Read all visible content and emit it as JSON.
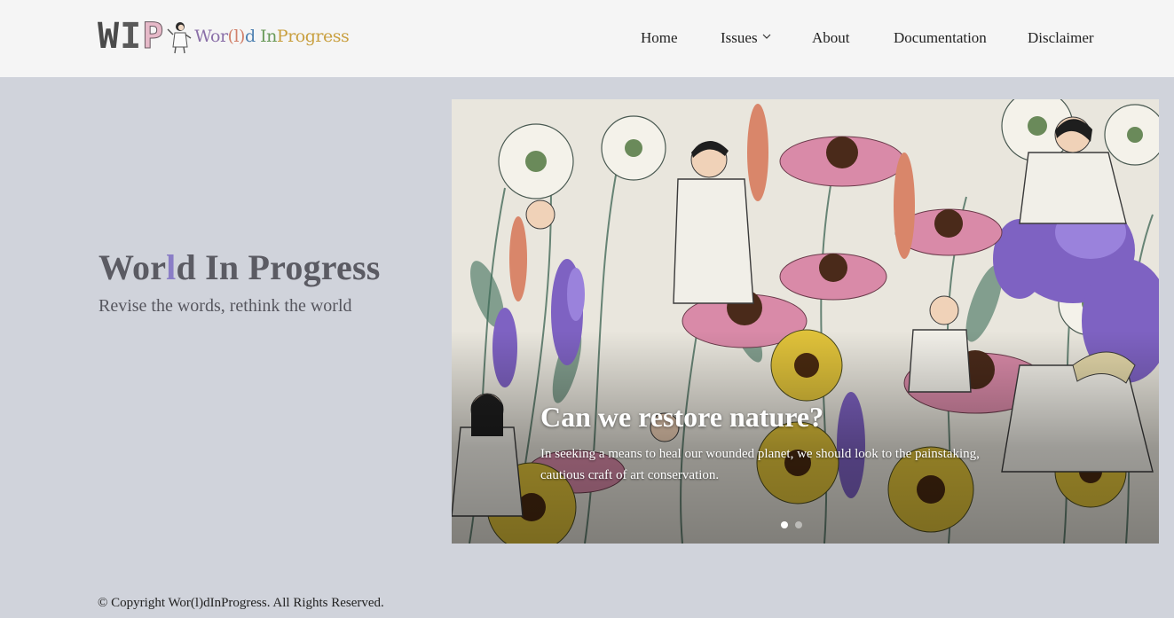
{
  "brand": {
    "logo_letters": [
      "W",
      "I",
      "P"
    ],
    "logo_script": [
      "Wor",
      "(l)",
      "d ",
      "In",
      "Progress"
    ],
    "logo_alt": "Wor(l)d In Progress"
  },
  "nav": {
    "items": [
      {
        "label": "Home"
      },
      {
        "label": "Issues",
        "has_dropdown": true
      },
      {
        "label": "About"
      },
      {
        "label": "Documentation"
      },
      {
        "label": "Disclaimer"
      }
    ]
  },
  "hero": {
    "title_before": "Wor",
    "title_accent": "l",
    "title_after": "d In Progress",
    "subtitle": "Revise the words, rethink the world"
  },
  "carousel": {
    "slide_title": "Can we restore nature?",
    "slide_text": "In seeking a means to heal our wounded planet, we should look to the painstaking, cautious craft of art conservation.",
    "slide_count": 2,
    "active_index": 0
  },
  "footer": {
    "copyright": "© Copyright Wor(l)dInProgress. All Rights Reserved."
  },
  "colors": {
    "header_bg": "#f5f5f5",
    "page_bg": "#d0d3db",
    "title_accent": "#8a7dc6",
    "text": "#222222"
  }
}
